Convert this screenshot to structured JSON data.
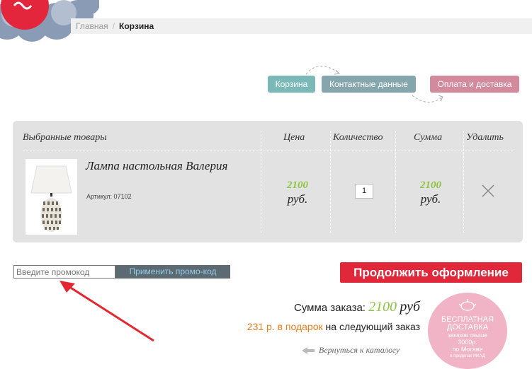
{
  "breadcrumb": {
    "home": "Главная",
    "separator": "/",
    "current": "Корзина"
  },
  "steps": {
    "cart": "Корзина",
    "contacts": "Контактные данные",
    "payment": "Оплата и доставка"
  },
  "table": {
    "headers": {
      "products": "Выбранные товары",
      "price": "Цена",
      "quantity": "Количество",
      "sum": "Сумма",
      "delete": "Удалить"
    },
    "items": [
      {
        "name": "Лампа настольная Валерия",
        "sku": "Артикул: 07102",
        "price": "2100",
        "price_currency": "руб.",
        "quantity": "1",
        "sum": "2100",
        "sum_currency": "руб."
      }
    ]
  },
  "promo": {
    "placeholder": "Введите промокод",
    "button": "Применить промо-код"
  },
  "continue_button": "Продолжить оформление",
  "summary": {
    "total_label": "Сумма заказа:",
    "total_value": "2100",
    "total_currency": "руб",
    "gift_amount": "231 р. в подарок",
    "gift_text": "на следующий заказ"
  },
  "back_link": "Вернуться к каталогу",
  "badge": {
    "line1": "БЕСПЛАТНАЯ",
    "line2": "ДОСТАВКА",
    "line3": "заказов свыше",
    "line4": "3000р.",
    "line5": "по Москве",
    "line6": "в пределах МКАД"
  },
  "colors": {
    "green": "#8cc63f",
    "red_button": "#e0283a",
    "badge_pink": "#f0b4c6",
    "gift_orange": "#e67e22"
  }
}
